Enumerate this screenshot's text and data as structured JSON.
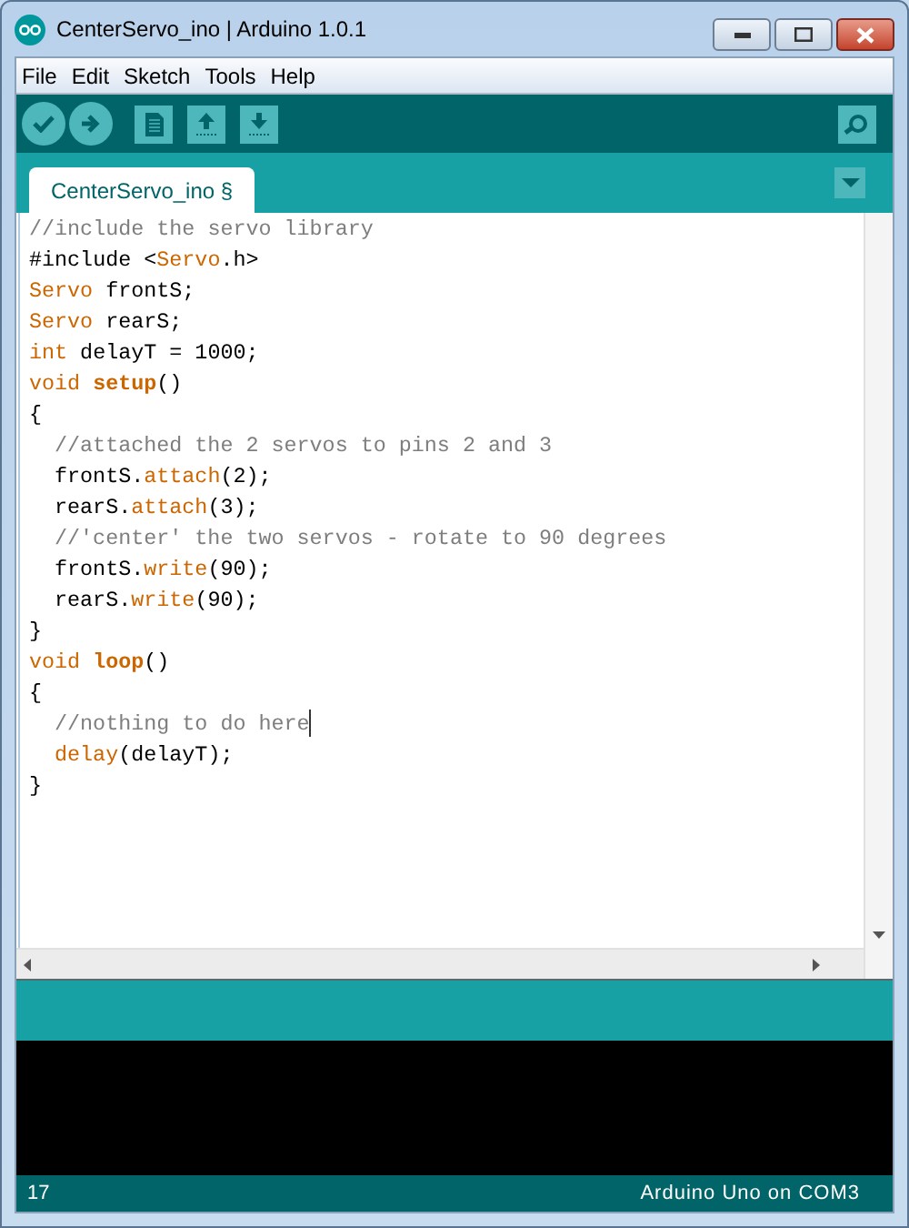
{
  "window": {
    "title": "CenterServo_ino | Arduino 1.0.1"
  },
  "menu": [
    "File",
    "Edit",
    "Sketch",
    "Tools",
    "Help"
  ],
  "tabs": [
    {
      "label": "CenterServo_ino §",
      "selected": true
    }
  ],
  "editor": {
    "lines": [
      {
        "tokens": [
          {
            "kind": "comment",
            "text": "//include the servo library"
          }
        ]
      },
      {
        "tokens": [
          {
            "kind": "plain",
            "text": "#include <"
          },
          {
            "kind": "type",
            "text": "Servo"
          },
          {
            "kind": "plain",
            "text": ".h>"
          }
        ]
      },
      {
        "tokens": [
          {
            "kind": "type",
            "text": "Servo"
          },
          {
            "kind": "plain",
            "text": " frontS;"
          }
        ]
      },
      {
        "tokens": [
          {
            "kind": "type",
            "text": "Servo"
          },
          {
            "kind": "plain",
            "text": " rearS;"
          }
        ]
      },
      {
        "tokens": [
          {
            "kind": "type",
            "text": "int"
          },
          {
            "kind": "plain",
            "text": " delayT = 1000;"
          }
        ]
      },
      {
        "tokens": [
          {
            "kind": "type",
            "text": "void "
          },
          {
            "kind": "keyword",
            "text": "setup"
          },
          {
            "kind": "plain",
            "text": "()"
          }
        ]
      },
      {
        "tokens": [
          {
            "kind": "plain",
            "text": "{"
          }
        ]
      },
      {
        "indent": true,
        "tokens": [
          {
            "kind": "comment",
            "text": "//attached the 2 servos to pins 2 and 3"
          }
        ]
      },
      {
        "indent": true,
        "tokens": [
          {
            "kind": "plain",
            "text": "frontS."
          },
          {
            "kind": "function",
            "text": "attach"
          },
          {
            "kind": "plain",
            "text": "(2);"
          }
        ]
      },
      {
        "indent": true,
        "tokens": [
          {
            "kind": "plain",
            "text": "rearS."
          },
          {
            "kind": "function",
            "text": "attach"
          },
          {
            "kind": "plain",
            "text": "(3);"
          }
        ]
      },
      {
        "indent": true,
        "tokens": [
          {
            "kind": "comment",
            "text": "//'center' the two servos - rotate to 90 degrees"
          }
        ]
      },
      {
        "indent": true,
        "tokens": [
          {
            "kind": "plain",
            "text": "frontS."
          },
          {
            "kind": "function",
            "text": "write"
          },
          {
            "kind": "plain",
            "text": "(90);"
          }
        ]
      },
      {
        "indent": true,
        "tokens": [
          {
            "kind": "plain",
            "text": "rearS."
          },
          {
            "kind": "function",
            "text": "write"
          },
          {
            "kind": "plain",
            "text": "(90);"
          }
        ]
      },
      {
        "tokens": [
          {
            "kind": "plain",
            "text": "}"
          }
        ]
      },
      {
        "tokens": [
          {
            "kind": "type",
            "text": "void "
          },
          {
            "kind": "keyword",
            "text": "loop"
          },
          {
            "kind": "plain",
            "text": "()"
          }
        ]
      },
      {
        "tokens": [
          {
            "kind": "plain",
            "text": "{"
          }
        ]
      },
      {
        "indent": true,
        "tokens": [
          {
            "kind": "comment",
            "text": "//nothing to do here"
          }
        ],
        "cursor": true
      },
      {
        "indent": true,
        "tokens": [
          {
            "kind": "function",
            "text": "delay"
          },
          {
            "kind": "plain",
            "text": "(delayT);"
          }
        ]
      },
      {
        "tokens": [
          {
            "kind": "plain",
            "text": "}"
          }
        ]
      }
    ]
  },
  "status_bar": {
    "line": "17",
    "board": "Arduino Uno on COM3"
  }
}
